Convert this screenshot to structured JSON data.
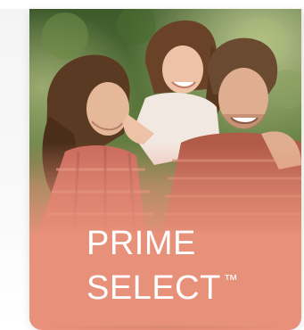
{
  "card": {
    "title_line1": "PRIME",
    "title_line2": "SELECT",
    "trademark": "™",
    "accent_color": "#e8917a",
    "image": {
      "subject": "family-photo",
      "icon": "photo-family"
    }
  }
}
